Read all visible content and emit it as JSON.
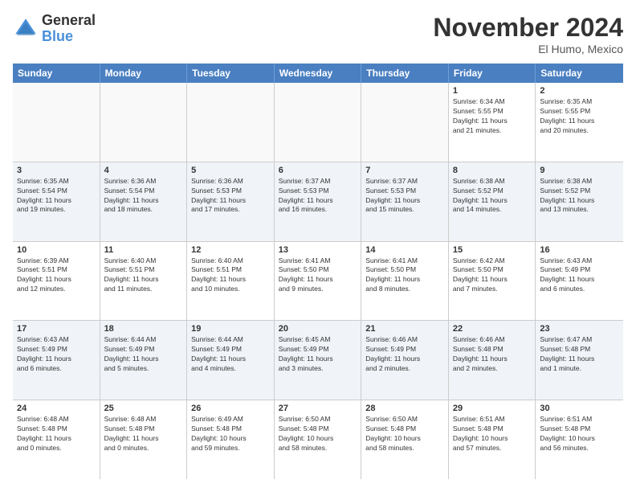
{
  "logo": {
    "general": "General",
    "blue": "Blue"
  },
  "title": "November 2024",
  "location": "El Humo, Mexico",
  "header_days": [
    "Sunday",
    "Monday",
    "Tuesday",
    "Wednesday",
    "Thursday",
    "Friday",
    "Saturday"
  ],
  "weeks": [
    [
      {
        "day": "",
        "info": "",
        "empty": true
      },
      {
        "day": "",
        "info": "",
        "empty": true
      },
      {
        "day": "",
        "info": "",
        "empty": true
      },
      {
        "day": "",
        "info": "",
        "empty": true
      },
      {
        "day": "",
        "info": "",
        "empty": true
      },
      {
        "day": "1",
        "info": "Sunrise: 6:34 AM\nSunset: 5:55 PM\nDaylight: 11 hours\nand 21 minutes.",
        "empty": false
      },
      {
        "day": "2",
        "info": "Sunrise: 6:35 AM\nSunset: 5:55 PM\nDaylight: 11 hours\nand 20 minutes.",
        "empty": false
      }
    ],
    [
      {
        "day": "3",
        "info": "Sunrise: 6:35 AM\nSunset: 5:54 PM\nDaylight: 11 hours\nand 19 minutes.",
        "empty": false
      },
      {
        "day": "4",
        "info": "Sunrise: 6:36 AM\nSunset: 5:54 PM\nDaylight: 11 hours\nand 18 minutes.",
        "empty": false
      },
      {
        "day": "5",
        "info": "Sunrise: 6:36 AM\nSunset: 5:53 PM\nDaylight: 11 hours\nand 17 minutes.",
        "empty": false
      },
      {
        "day": "6",
        "info": "Sunrise: 6:37 AM\nSunset: 5:53 PM\nDaylight: 11 hours\nand 16 minutes.",
        "empty": false
      },
      {
        "day": "7",
        "info": "Sunrise: 6:37 AM\nSunset: 5:53 PM\nDaylight: 11 hours\nand 15 minutes.",
        "empty": false
      },
      {
        "day": "8",
        "info": "Sunrise: 6:38 AM\nSunset: 5:52 PM\nDaylight: 11 hours\nand 14 minutes.",
        "empty": false
      },
      {
        "day": "9",
        "info": "Sunrise: 6:38 AM\nSunset: 5:52 PM\nDaylight: 11 hours\nand 13 minutes.",
        "empty": false
      }
    ],
    [
      {
        "day": "10",
        "info": "Sunrise: 6:39 AM\nSunset: 5:51 PM\nDaylight: 11 hours\nand 12 minutes.",
        "empty": false
      },
      {
        "day": "11",
        "info": "Sunrise: 6:40 AM\nSunset: 5:51 PM\nDaylight: 11 hours\nand 11 minutes.",
        "empty": false
      },
      {
        "day": "12",
        "info": "Sunrise: 6:40 AM\nSunset: 5:51 PM\nDaylight: 11 hours\nand 10 minutes.",
        "empty": false
      },
      {
        "day": "13",
        "info": "Sunrise: 6:41 AM\nSunset: 5:50 PM\nDaylight: 11 hours\nand 9 minutes.",
        "empty": false
      },
      {
        "day": "14",
        "info": "Sunrise: 6:41 AM\nSunset: 5:50 PM\nDaylight: 11 hours\nand 8 minutes.",
        "empty": false
      },
      {
        "day": "15",
        "info": "Sunrise: 6:42 AM\nSunset: 5:50 PM\nDaylight: 11 hours\nand 7 minutes.",
        "empty": false
      },
      {
        "day": "16",
        "info": "Sunrise: 6:43 AM\nSunset: 5:49 PM\nDaylight: 11 hours\nand 6 minutes.",
        "empty": false
      }
    ],
    [
      {
        "day": "17",
        "info": "Sunrise: 6:43 AM\nSunset: 5:49 PM\nDaylight: 11 hours\nand 6 minutes.",
        "empty": false
      },
      {
        "day": "18",
        "info": "Sunrise: 6:44 AM\nSunset: 5:49 PM\nDaylight: 11 hours\nand 5 minutes.",
        "empty": false
      },
      {
        "day": "19",
        "info": "Sunrise: 6:44 AM\nSunset: 5:49 PM\nDaylight: 11 hours\nand 4 minutes.",
        "empty": false
      },
      {
        "day": "20",
        "info": "Sunrise: 6:45 AM\nSunset: 5:49 PM\nDaylight: 11 hours\nand 3 minutes.",
        "empty": false
      },
      {
        "day": "21",
        "info": "Sunrise: 6:46 AM\nSunset: 5:49 PM\nDaylight: 11 hours\nand 2 minutes.",
        "empty": false
      },
      {
        "day": "22",
        "info": "Sunrise: 6:46 AM\nSunset: 5:48 PM\nDaylight: 11 hours\nand 2 minutes.",
        "empty": false
      },
      {
        "day": "23",
        "info": "Sunrise: 6:47 AM\nSunset: 5:48 PM\nDaylight: 11 hours\nand 1 minute.",
        "empty": false
      }
    ],
    [
      {
        "day": "24",
        "info": "Sunrise: 6:48 AM\nSunset: 5:48 PM\nDaylight: 11 hours\nand 0 minutes.",
        "empty": false
      },
      {
        "day": "25",
        "info": "Sunrise: 6:48 AM\nSunset: 5:48 PM\nDaylight: 11 hours\nand 0 minutes.",
        "empty": false
      },
      {
        "day": "26",
        "info": "Sunrise: 6:49 AM\nSunset: 5:48 PM\nDaylight: 10 hours\nand 59 minutes.",
        "empty": false
      },
      {
        "day": "27",
        "info": "Sunrise: 6:50 AM\nSunset: 5:48 PM\nDaylight: 10 hours\nand 58 minutes.",
        "empty": false
      },
      {
        "day": "28",
        "info": "Sunrise: 6:50 AM\nSunset: 5:48 PM\nDaylight: 10 hours\nand 58 minutes.",
        "empty": false
      },
      {
        "day": "29",
        "info": "Sunrise: 6:51 AM\nSunset: 5:48 PM\nDaylight: 10 hours\nand 57 minutes.",
        "empty": false
      },
      {
        "day": "30",
        "info": "Sunrise: 6:51 AM\nSunset: 5:48 PM\nDaylight: 10 hours\nand 56 minutes.",
        "empty": false
      }
    ]
  ]
}
